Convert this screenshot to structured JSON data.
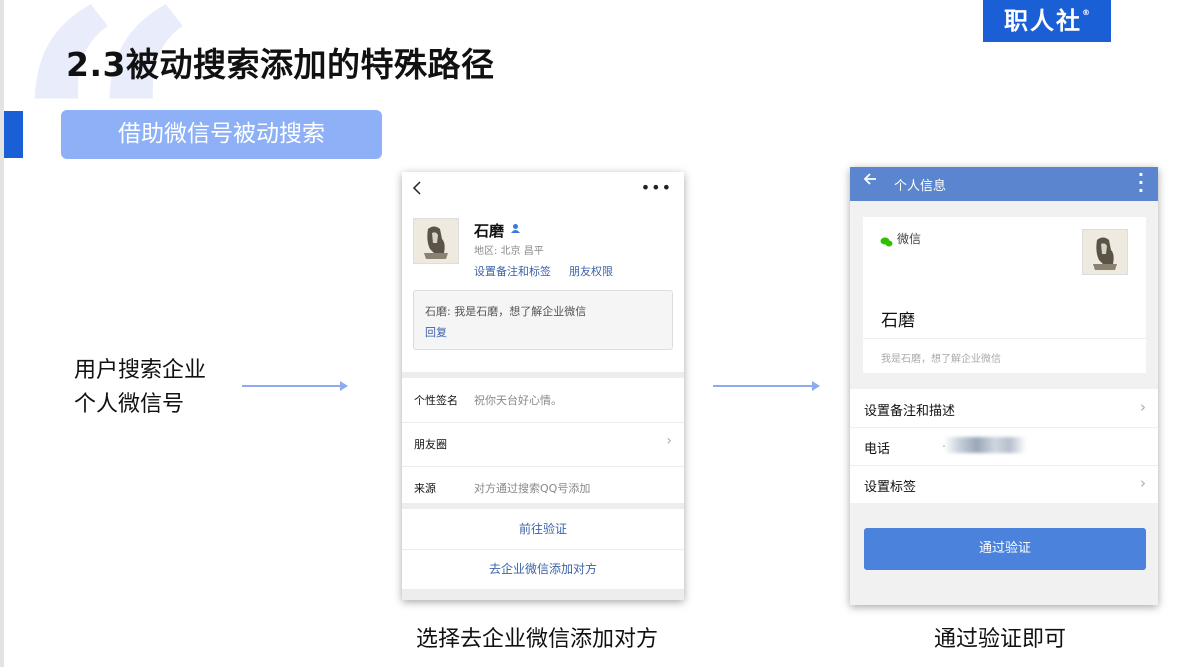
{
  "slide": {
    "title": "2.3被动搜索添加的特殊路径",
    "brand": "职人社",
    "brand_mark": "®",
    "subtag": "借助微信号被动搜索",
    "side_text": [
      "用户搜索企业",
      "个人微信号"
    ],
    "captions": [
      "选择去企业微信添加对方",
      "通过验证即可"
    ]
  },
  "phone1": {
    "back_icon": "chevron-left-icon",
    "more_icon": "more-dots-icon",
    "name": "石磨",
    "region": "地区: 北京 昌平",
    "link_remark": "设置备注和标签",
    "link_permission": "朋友权限",
    "message": "石磨: 我是石磨，想了解企业微信",
    "reply": "回复",
    "rows": [
      {
        "label": "个性签名",
        "value": "祝你天台好心情。"
      },
      {
        "label": "朋友圈",
        "value": ""
      },
      {
        "label": "来源",
        "value": "对方通过搜索QQ号添加"
      }
    ],
    "actions": [
      "前往验证",
      "去企业微信添加对方"
    ]
  },
  "phone2": {
    "header_title": "个人信息",
    "wx_label": "微信",
    "name": "石磨",
    "signature": "我是石磨，想了解企业微信",
    "rows": [
      "设置备注和描述",
      "电话",
      "设置标签"
    ],
    "phone_value": ". .",
    "verify_button": "通过验证"
  },
  "colors": {
    "brand_blue": "#1a5fd6",
    "subtag_blue": "#8eb0f6",
    "header_blue": "#5b86cf",
    "button_blue": "#4a82dc",
    "link_blue": "#3d62a8",
    "wechat_green": "#2dc100"
  }
}
